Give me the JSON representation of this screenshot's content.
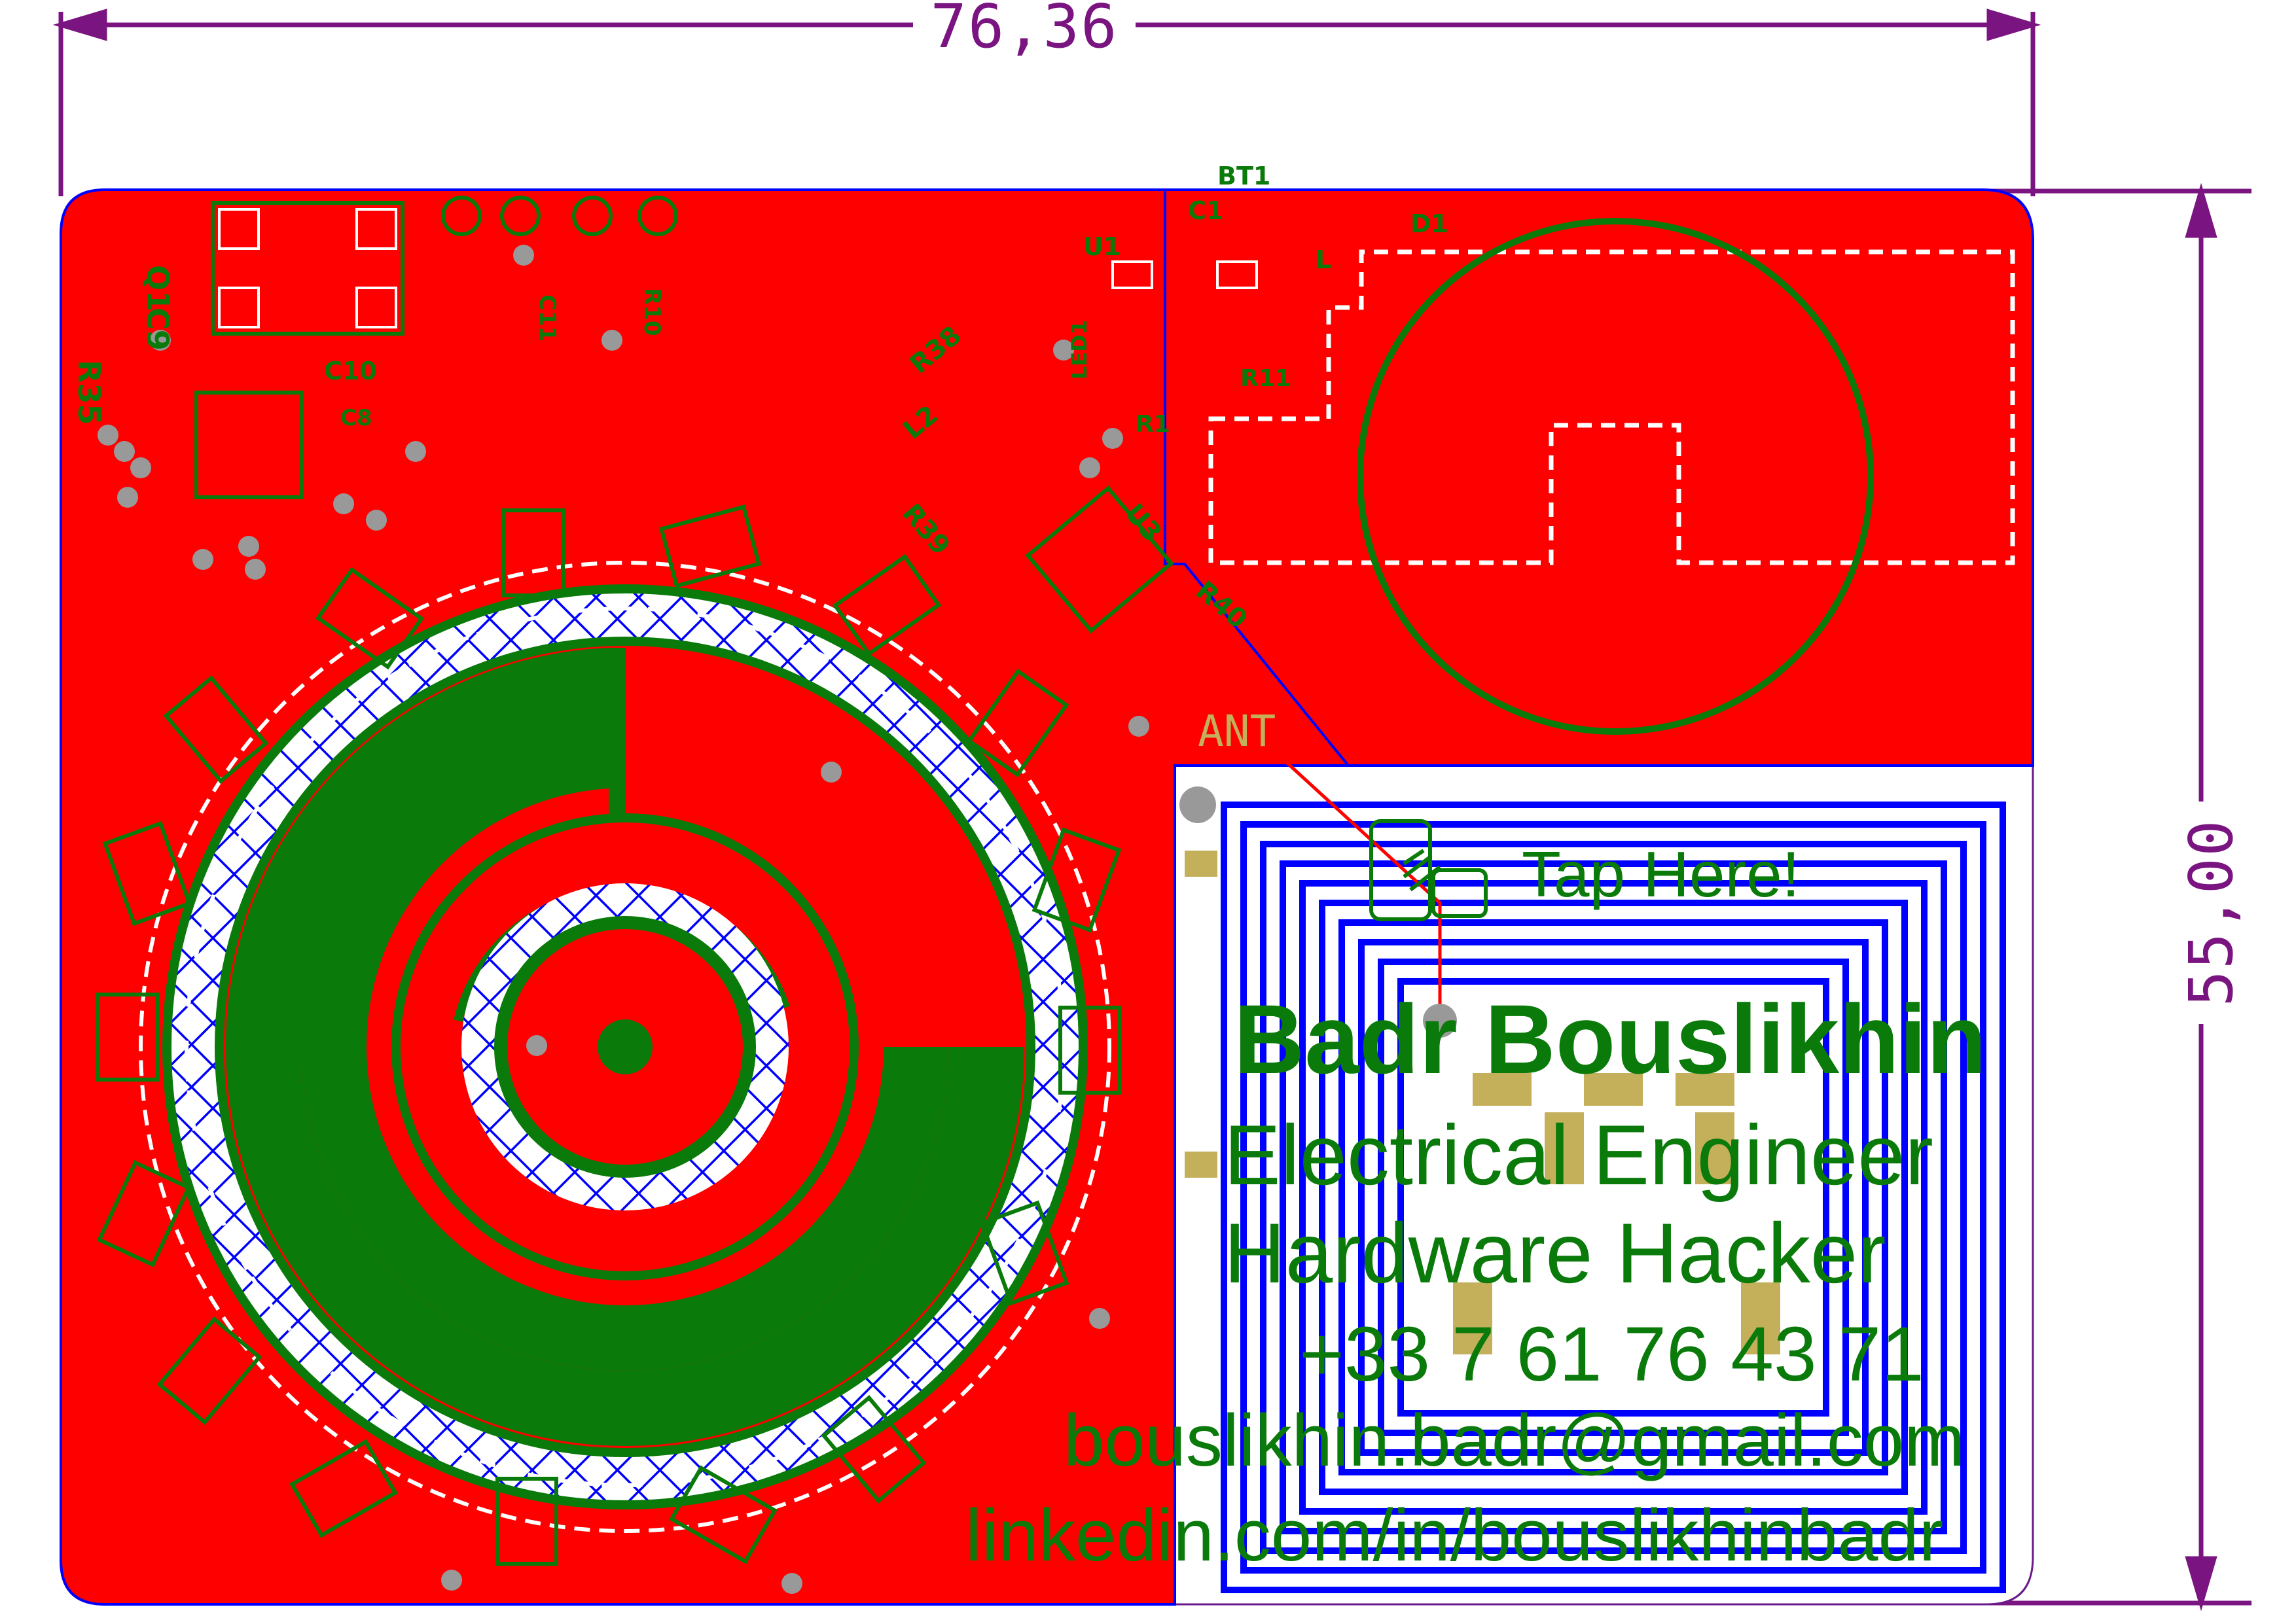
{
  "dimensions": {
    "width_label": "76,36",
    "height_label": "55,00"
  },
  "card": {
    "tap_label": "Tap Here!",
    "name": "Badr Bouslikhin",
    "title_1": "Electrical Engineer",
    "title_2": "Hardware Hacker",
    "phone": "+33 7 61 76 43 71",
    "email": "bouslikhin.badr@gmail.com",
    "linkedin": "linkedin.com/in/bouslikhinbadr"
  },
  "designators": {
    "bt1": "BT1",
    "c1": "C1",
    "d1": "D1",
    "u1": "U1",
    "l": "L",
    "q1": "Q1",
    "c9": "C9",
    "r35": "R35",
    "c10": "C10",
    "c8": "C8",
    "c11": "C11",
    "r10": "R10",
    "led1": "LED1",
    "r11": "R11",
    "r1": "R1",
    "l2": "L2",
    "u3": "U3",
    "r38": "R38",
    "r39": "R39",
    "r40": "R40",
    "ant": "ANT"
  },
  "colors": {
    "copper_top": "#ff0000",
    "copper_bottom": "#0000ff",
    "silkscreen": "#0a7a0a",
    "dimension": "#7a1480",
    "pad": "#c4b05a",
    "via": "#999999"
  }
}
